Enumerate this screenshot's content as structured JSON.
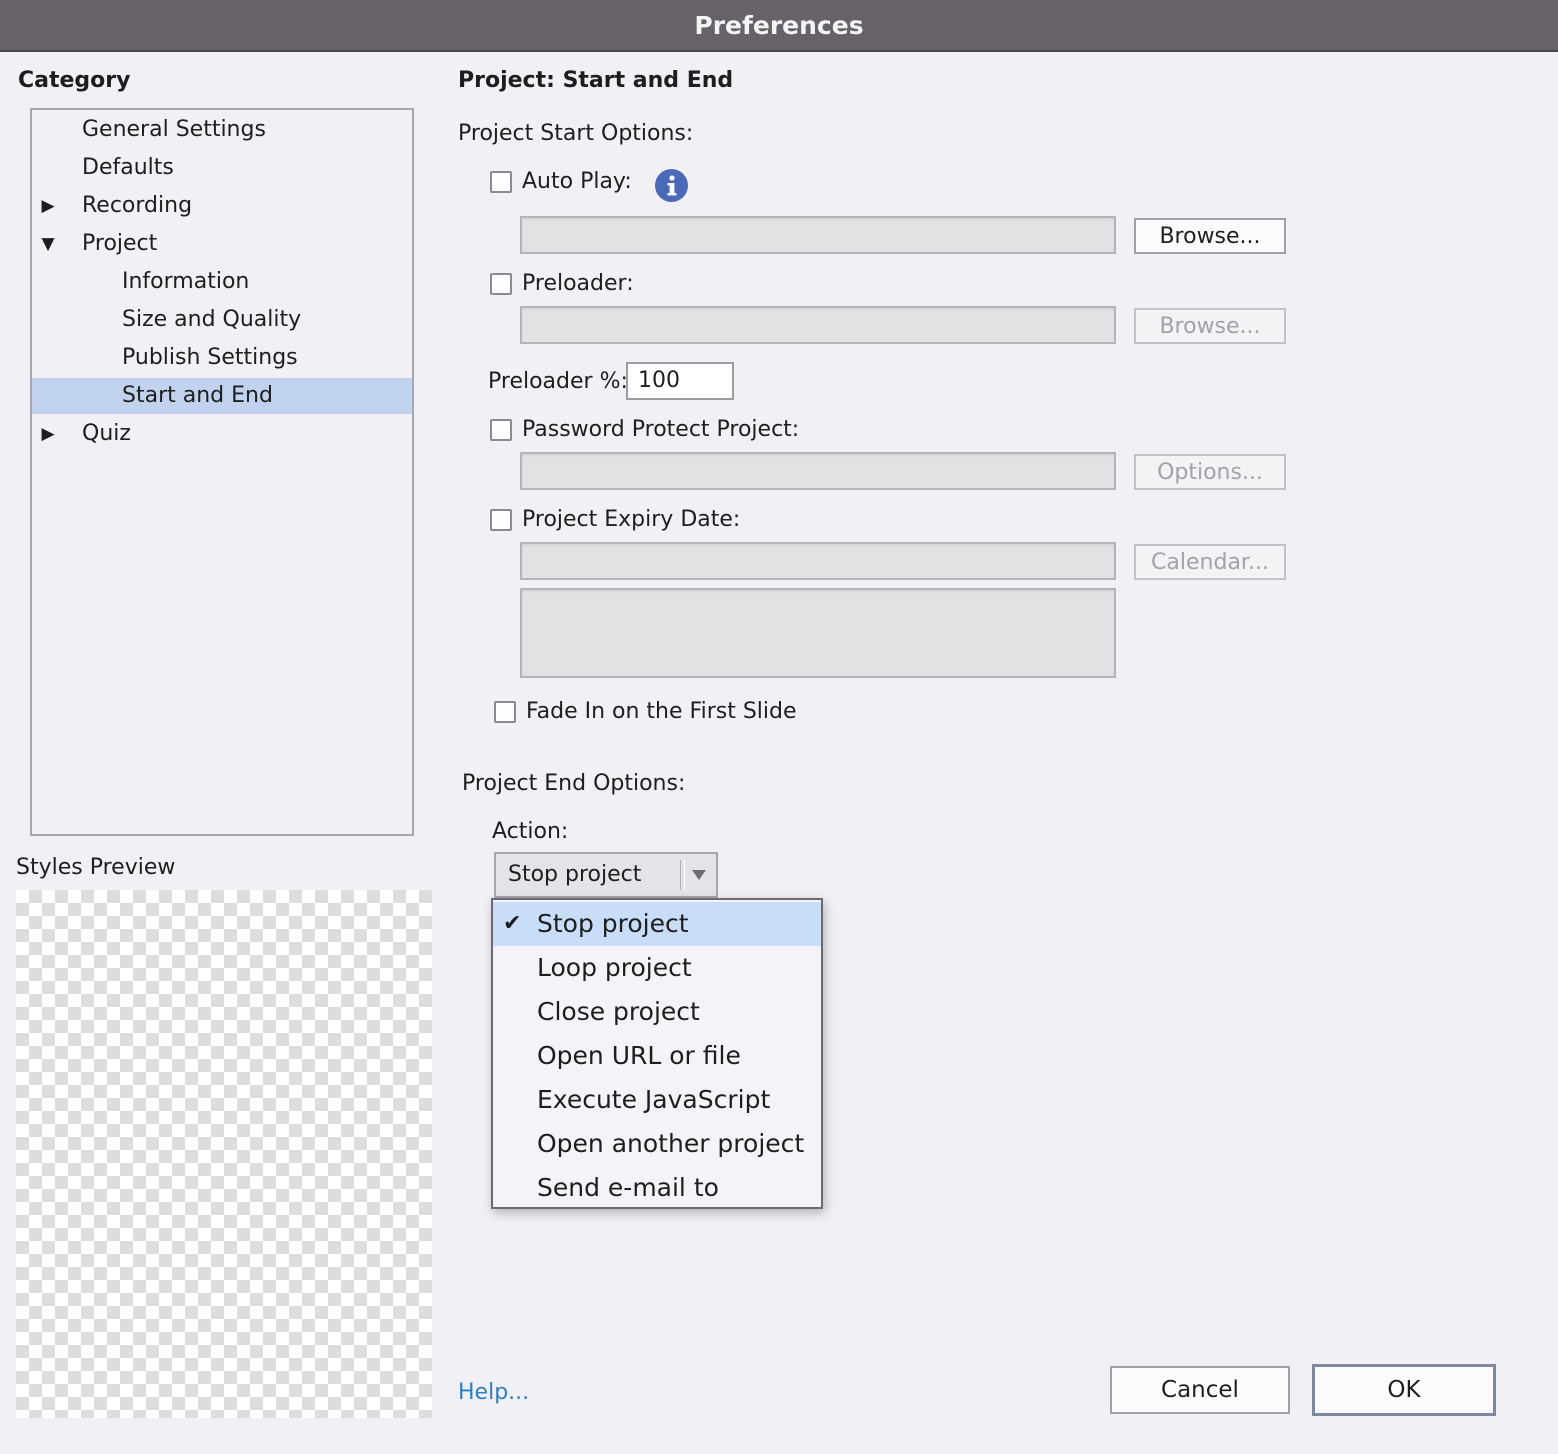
{
  "window": {
    "title": "Preferences"
  },
  "category": {
    "heading": "Category",
    "items": [
      {
        "label": "General Settings"
      },
      {
        "label": "Defaults"
      },
      {
        "label": "Recording"
      },
      {
        "label": "Project"
      },
      {
        "label": "Information"
      },
      {
        "label": "Size and Quality"
      },
      {
        "label": "Publish Settings"
      },
      {
        "label": "Start and End"
      },
      {
        "label": "Quiz"
      }
    ],
    "selected": "Start and End"
  },
  "preview": {
    "heading": "Styles Preview"
  },
  "panel": {
    "title": "Project: Start and End",
    "start_options_heading": "Project Start Options:",
    "auto_play": {
      "label": "Auto Play:",
      "checked": false,
      "field_value": "",
      "button": "Browse..."
    },
    "preloader": {
      "label": "Preloader:",
      "checked": false,
      "field_value": "",
      "button": "Browse..."
    },
    "preloader_pct": {
      "label": "Preloader %:",
      "value": "100"
    },
    "password": {
      "label": "Password Protect Project:",
      "checked": false,
      "field_value": "",
      "button": "Options..."
    },
    "expiry": {
      "label": "Project Expiry Date:",
      "checked": false,
      "field_value": "",
      "message": "",
      "button": "Calendar..."
    },
    "fade_in": {
      "label": "Fade In on the First Slide",
      "checked": false
    },
    "end_options_heading": "Project End Options:",
    "action": {
      "label": "Action:",
      "selected": "Stop project",
      "options": [
        "Stop project",
        "Loop project",
        "Close project",
        "Open URL or file",
        "Execute JavaScript",
        "Open another project",
        "Send e-mail to"
      ],
      "check_glyph": "✔"
    }
  },
  "footer": {
    "help": "Help...",
    "cancel": "Cancel",
    "ok": "OK"
  },
  "colors": {
    "titlebar": "#67626a",
    "selection": "#c0d2ee",
    "link": "#2f7fc2",
    "info": "#4a6ab8"
  }
}
